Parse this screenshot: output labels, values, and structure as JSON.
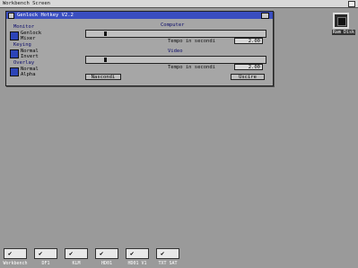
{
  "screen": {
    "title": "Workbench Screen"
  },
  "window": {
    "title": "Genlock Hotkey V2.2",
    "groups": [
      {
        "title": "Monitor",
        "options": [
          "Genlock",
          "Mixer"
        ]
      },
      {
        "title": "Keying",
        "options": [
          "Normal",
          "Invert"
        ]
      },
      {
        "title": "Overlay",
        "options": [
          "Normal",
          "Alpha"
        ]
      }
    ],
    "computer": {
      "label": "Computer",
      "tempo_label": "Tempo in secondi",
      "tempo_value": "2.00"
    },
    "video": {
      "label": "Video",
      "tempo_label": "Tempo in secondi",
      "tempo_value": "2.00"
    },
    "buttons": {
      "hide": "Nascondi",
      "quit": "Uscire"
    }
  },
  "desktop": {
    "ram_disk_label": "Ram Disk"
  },
  "dock": {
    "items": [
      {
        "label": "Workbench"
      },
      {
        "label": "DF1"
      },
      {
        "label": "KLM"
      },
      {
        "label": "HD01"
      },
      {
        "label": "HD01 V1"
      },
      {
        "label": "TXT SAT"
      }
    ]
  }
}
